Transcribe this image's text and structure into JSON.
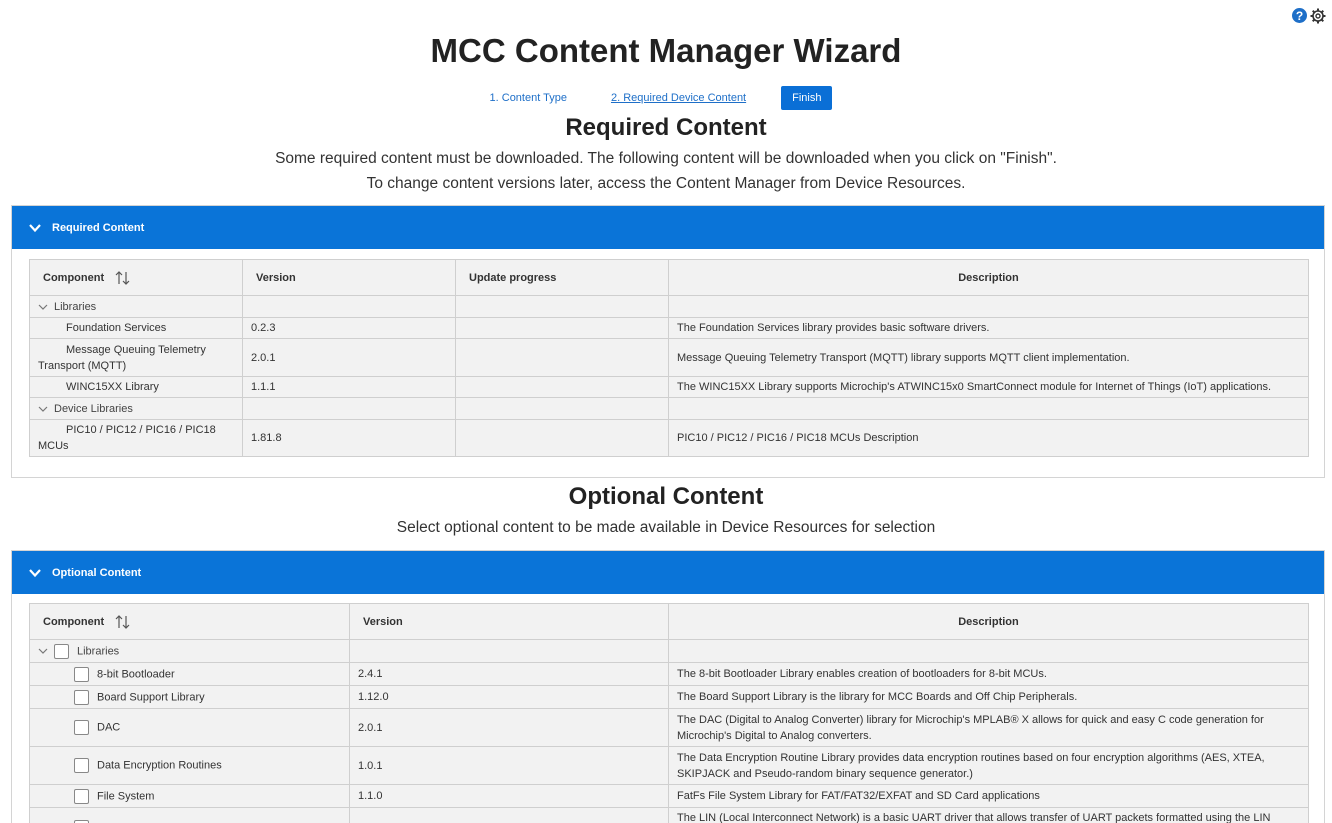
{
  "header": {
    "title": "MCC Content Manager Wizard",
    "help_icon": "?",
    "steps": [
      {
        "label": "1. Content Type"
      },
      {
        "label": "2. Required Device Content"
      }
    ],
    "finish_label": "Finish"
  },
  "required": {
    "heading": "Required Content",
    "line1": "Some required content must be downloaded. The following content will be downloaded when you click on \"Finish\".",
    "line2": "To change content versions later, access the Content Manager from Device Resources.",
    "panel_title": "Required Content",
    "columns": [
      "Component",
      "Version",
      "Update progress",
      "Description"
    ],
    "groups": [
      {
        "name": "Libraries",
        "rows": [
          {
            "component": "Foundation Services",
            "version": "0.2.3",
            "description": "The Foundation Services library provides basic software drivers."
          },
          {
            "component": "Message Queuing Telemetry Transport (MQTT)",
            "version": "2.0.1",
            "description": "Message Queuing Telemetry Transport (MQTT) library supports MQTT client implementation."
          },
          {
            "component": "WINC15XX Library",
            "version": "1.1.1",
            "description": "The WINC15XX Library supports Microchip's ATWINC15x0 SmartConnect module for Internet of Things (IoT) applications."
          }
        ]
      },
      {
        "name": "Device Libraries",
        "rows": [
          {
            "component": "PIC10 / PIC12 / PIC16 / PIC18 MCUs",
            "version": "1.81.8",
            "description": "PIC10 / PIC12 / PIC16 / PIC18 MCUs Description"
          }
        ]
      }
    ]
  },
  "optional": {
    "heading": "Optional Content",
    "line1": "Select optional content to be made available in Device Resources for selection",
    "panel_title": "Optional Content",
    "columns": [
      "Component",
      "Version",
      "Description"
    ],
    "group": "Libraries",
    "rows": [
      {
        "component": "8-bit Bootloader",
        "version": "2.4.1",
        "description": "The 8-bit Bootloader Library enables creation of bootloaders for 8-bit MCUs."
      },
      {
        "component": "Board Support Library",
        "version": "1.12.0",
        "description": "The Board Support Library is the library for MCC Boards and Off Chip Peripherals."
      },
      {
        "component": "DAC",
        "version": "2.0.1",
        "description": "The DAC (Digital to Analog Converter) library for Microchip's MPLAB® X allows for quick and easy C code generation for Microchip's Digital to Analog converters."
      },
      {
        "component": "Data Encryption Routines",
        "version": "1.0.1",
        "description": "The Data Encryption Routine Library provides data encryption routines based on four encryption algorithms (AES, XTEA, SKIPJACK and Pseudo-random binary sequence generator.)"
      },
      {
        "component": "File System",
        "version": "1.1.0",
        "description": "FatFs File System Library for FAT/FAT32/EXFAT and SD Card applications"
      },
      {
        "component": "",
        "version": "",
        "description": "The LIN (Local Interconnect Network) is a basic UART driver that allows transfer of UART packets formatted using the LIN"
      }
    ]
  }
}
